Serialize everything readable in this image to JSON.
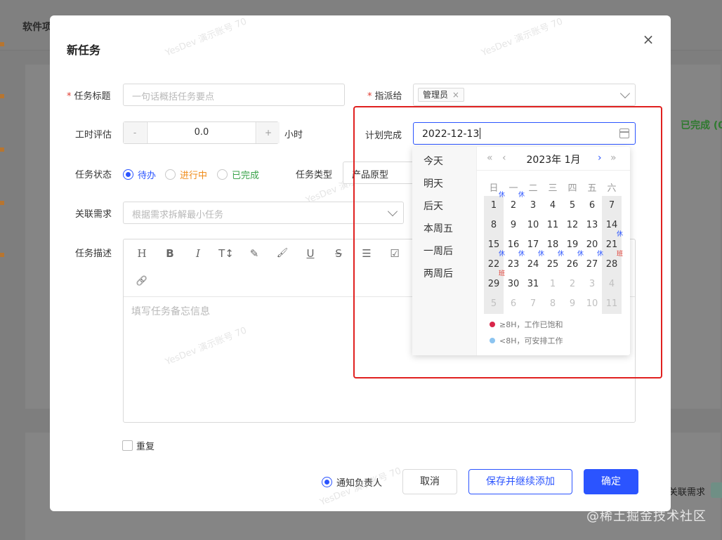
{
  "background": {
    "app_title": "软件项",
    "status_right": "已完成 (0",
    "related_label": "关联需求",
    "corner_watermark": "@稀土掘金技术社区"
  },
  "modal": {
    "title": "新任务",
    "close_icon": "close-icon",
    "fields": {
      "task_title": {
        "label": "任务标题",
        "placeholder": "一句话概括任务要点"
      },
      "assignee": {
        "label": "指派给",
        "tag": "管理员"
      },
      "estimate": {
        "label": "工时评估",
        "value": "0.0",
        "unit": "小时",
        "minus": "-",
        "plus": "+"
      },
      "plan_finish": {
        "label": "计划完成",
        "value": "2022-12-13"
      },
      "status": {
        "label": "任务状态",
        "options": [
          {
            "label": "待办",
            "color": "#2b54ff",
            "selected": true
          },
          {
            "label": "进行中",
            "color": "#f08c1a",
            "selected": false
          },
          {
            "label": "已完成",
            "color": "#3aa34a",
            "selected": false
          }
        ]
      },
      "task_type": {
        "label": "任务类型",
        "value": "产品原型"
      },
      "related": {
        "label": "关联需求",
        "placeholder": "根据需求拆解最小任务"
      },
      "description": {
        "label": "任务描述",
        "placeholder": "填写任务备忘信息"
      }
    },
    "toolbar": [
      "heading-icon",
      "bold-icon",
      "italic-icon",
      "font-size-icon",
      "highlight-icon",
      "brush-icon",
      "underline-icon",
      "strikethrough-icon",
      "list-icon",
      "checkbox-icon",
      "link-icon"
    ],
    "toolbar_glyphs": [
      "H",
      "B",
      "I",
      "T↕",
      "✎",
      "🖌",
      "U",
      "S",
      "☰",
      "☑",
      "🔗"
    ],
    "repeat_label": "重复",
    "notify_label": "通知负责人",
    "buttons": {
      "cancel": "取消",
      "save_continue": "保存并继续添加",
      "ok": "确定"
    },
    "watermark": "YesDev 演示账号 70"
  },
  "picker": {
    "shortcuts": [
      "今天",
      "明天",
      "后天",
      "本周五",
      "一周后",
      "两周后"
    ],
    "month_title": "2023年 1月",
    "nav": {
      "prev_year": "«",
      "prev_month": "‹",
      "next_month": "›",
      "next_year": "»"
    },
    "weekdays": [
      "日",
      "一",
      "二",
      "三",
      "四",
      "五",
      "六"
    ],
    "weeks": [
      [
        {
          "d": "1",
          "m": "休"
        },
        {
          "d": "2",
          "m": "休"
        },
        {
          "d": "3"
        },
        {
          "d": "4"
        },
        {
          "d": "5"
        },
        {
          "d": "6"
        },
        {
          "d": "7"
        }
      ],
      [
        {
          "d": "8"
        },
        {
          "d": "9"
        },
        {
          "d": "10"
        },
        {
          "d": "11"
        },
        {
          "d": "12"
        },
        {
          "d": "13"
        },
        {
          "d": "14"
        }
      ],
      [
        {
          "d": "15"
        },
        {
          "d": "16"
        },
        {
          "d": "17"
        },
        {
          "d": "18"
        },
        {
          "d": "19"
        },
        {
          "d": "20"
        },
        {
          "d": "21",
          "m": "休"
        }
      ],
      [
        {
          "d": "22",
          "m": "休"
        },
        {
          "d": "23",
          "m": "休"
        },
        {
          "d": "24",
          "m": "休"
        },
        {
          "d": "25",
          "m": "休"
        },
        {
          "d": "26",
          "m": "休"
        },
        {
          "d": "27",
          "m": "休"
        },
        {
          "d": "28",
          "m": "班"
        }
      ],
      [
        {
          "d": "29",
          "m": "班"
        },
        {
          "d": "30"
        },
        {
          "d": "31"
        },
        {
          "d": "1",
          "o": true
        },
        {
          "d": "2",
          "o": true
        },
        {
          "d": "3",
          "o": true
        },
        {
          "d": "4",
          "o": true
        }
      ],
      [
        {
          "d": "5",
          "o": true
        },
        {
          "d": "6",
          "o": true
        },
        {
          "d": "7",
          "o": true
        },
        {
          "d": "8",
          "o": true
        },
        {
          "d": "9",
          "o": true
        },
        {
          "d": "10",
          "o": true
        },
        {
          "d": "11",
          "o": true
        }
      ]
    ],
    "legend": [
      {
        "text": "≥8H，工作已饱和",
        "color": "#d9264a"
      },
      {
        "text": "<8H，可安排工作",
        "color": "#8cc4f0"
      }
    ]
  }
}
